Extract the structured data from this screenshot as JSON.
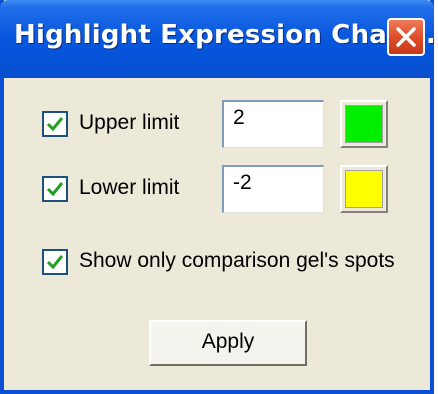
{
  "window": {
    "title": "Highlight Expression Chan...",
    "close_icon": "close-icon"
  },
  "upper": {
    "checked": true,
    "label": "Upper limit",
    "value": "2",
    "color": "#00ee00"
  },
  "lower": {
    "checked": true,
    "label": "Lower limit",
    "value": "-2",
    "color": "#ffff00"
  },
  "comparison": {
    "checked": true,
    "label": "Show only comparison gel's spots"
  },
  "apply": {
    "label": "Apply"
  }
}
